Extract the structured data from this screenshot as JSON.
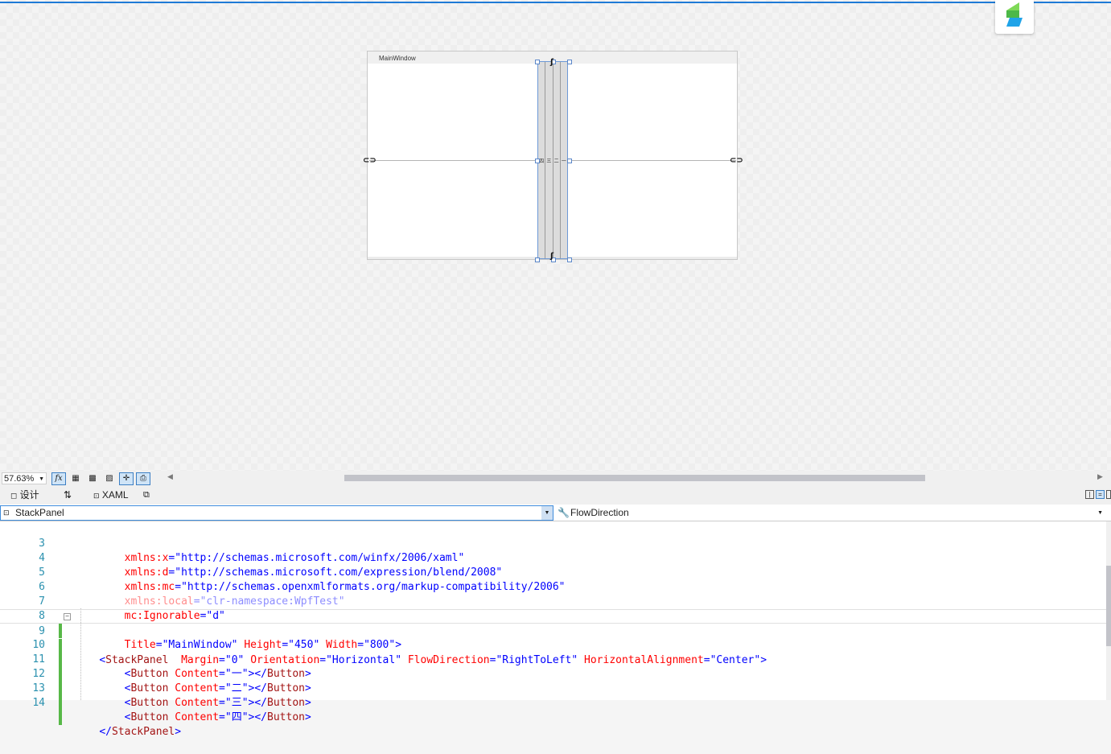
{
  "designer": {
    "window_title": "MainWindow",
    "buttons": [
      "四",
      "三",
      "二",
      "一"
    ],
    "accent_color": "#1e7ad6"
  },
  "toolbar": {
    "zoom": "57.63%",
    "fx_label": "fx"
  },
  "tabs": {
    "design_label": "设计",
    "swap_label": "⇅",
    "xaml_label": "XAML"
  },
  "nav": {
    "element": "StackPanel",
    "member": "FlowDirection"
  },
  "code": {
    "lines": [
      {
        "num": "3"
      },
      {
        "num": "4"
      },
      {
        "num": "5"
      },
      {
        "num": "6"
      },
      {
        "num": "7"
      },
      {
        "num": "8"
      },
      {
        "num": "9"
      },
      {
        "num": "10"
      },
      {
        "num": "11"
      },
      {
        "num": "12"
      },
      {
        "num": "13"
      },
      {
        "num": "14"
      }
    ],
    "l3": {
      "a1": "xmlns",
      "a2": ":x",
      "v": "\"http://schemas.microsoft.com/winfx/2006/xaml\""
    },
    "l4": {
      "a1": "xmlns",
      "a2": ":d",
      "v": "\"http://schemas.microsoft.com/expression/blend/2008\""
    },
    "l5": {
      "a1": "xmlns",
      "a2": ":mc",
      "v": "\"http://schemas.openxmlformats.org/markup-compatibility/2006\""
    },
    "l6": {
      "a1": "xmlns",
      "a2": ":local",
      "v": "\"clr-namespace:WpfTest\""
    },
    "l7": {
      "a1": "mc",
      "a2": ":Ignorable",
      "v": "\"d\""
    },
    "l8": {
      "a1": "Title",
      "v1": "\"MainWindow\"",
      "a2": "Height",
      "v2": "\"450\"",
      "a3": "Width",
      "v3": "\"800\"",
      "close": ">"
    },
    "l9": {
      "open": "<",
      "tag": "StackPanel",
      "a1": "Margin",
      "v1": "\"0\"",
      "a2": "Orientation",
      "v2": "\"Horizontal\"",
      "a3": "FlowDirection",
      "v3": "\"RightToLeft\"",
      "a4": "HorizontalAlignment",
      "v4": "\"Center\"",
      "close": ">"
    },
    "btn_lines": [
      {
        "content": "\"一\""
      },
      {
        "content": "\"二\""
      },
      {
        "content": "\"三\""
      },
      {
        "content": "\"四\""
      }
    ],
    "btn_tag": "Button",
    "btn_attr": "Content",
    "l14": {
      "close_tag": "StackPanel"
    }
  }
}
